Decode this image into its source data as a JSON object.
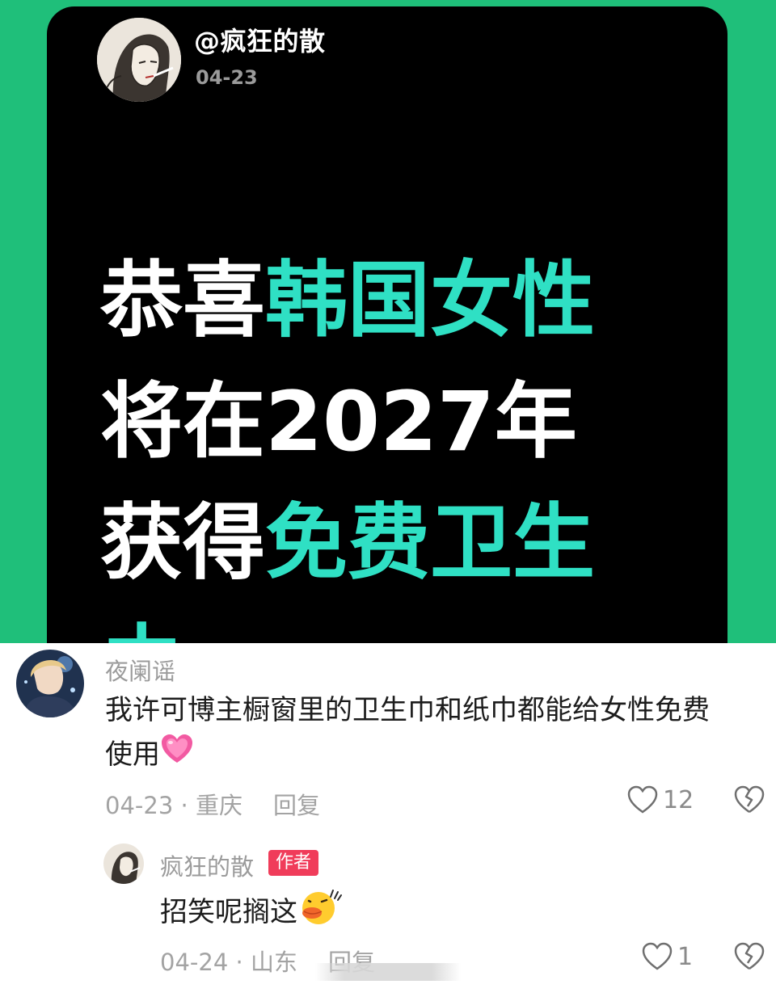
{
  "post": {
    "author": "@疯狂的散",
    "date": "04-23",
    "headline": {
      "line1_white": "恭喜",
      "line1_accent": "韩国女性",
      "line2_white": "将在2027年",
      "line3_white": "获得",
      "line3_accent": "免费卫生",
      "line4_accent": "巾"
    },
    "colors": {
      "background": "#1fbf7a",
      "card": "#000000",
      "accent": "#2fe0c4"
    }
  },
  "comments": [
    {
      "username": "夜阑谣",
      "text_line1": "我许可博主橱窗里的卫生巾和纸巾都能给女性免费",
      "text_line2": "使用",
      "emoji": "pink-heart-emoji",
      "date": "04-23",
      "location": "重庆",
      "reply_label": "回复",
      "likes": "12"
    },
    {
      "username": "疯狂的散",
      "badge": "作者",
      "text": "招笑呢搁这",
      "emoji": "duck-sweat-emoji",
      "date": "04-24",
      "location": "山东",
      "reply_label": "回复",
      "likes": "1"
    }
  ],
  "separator": " · "
}
